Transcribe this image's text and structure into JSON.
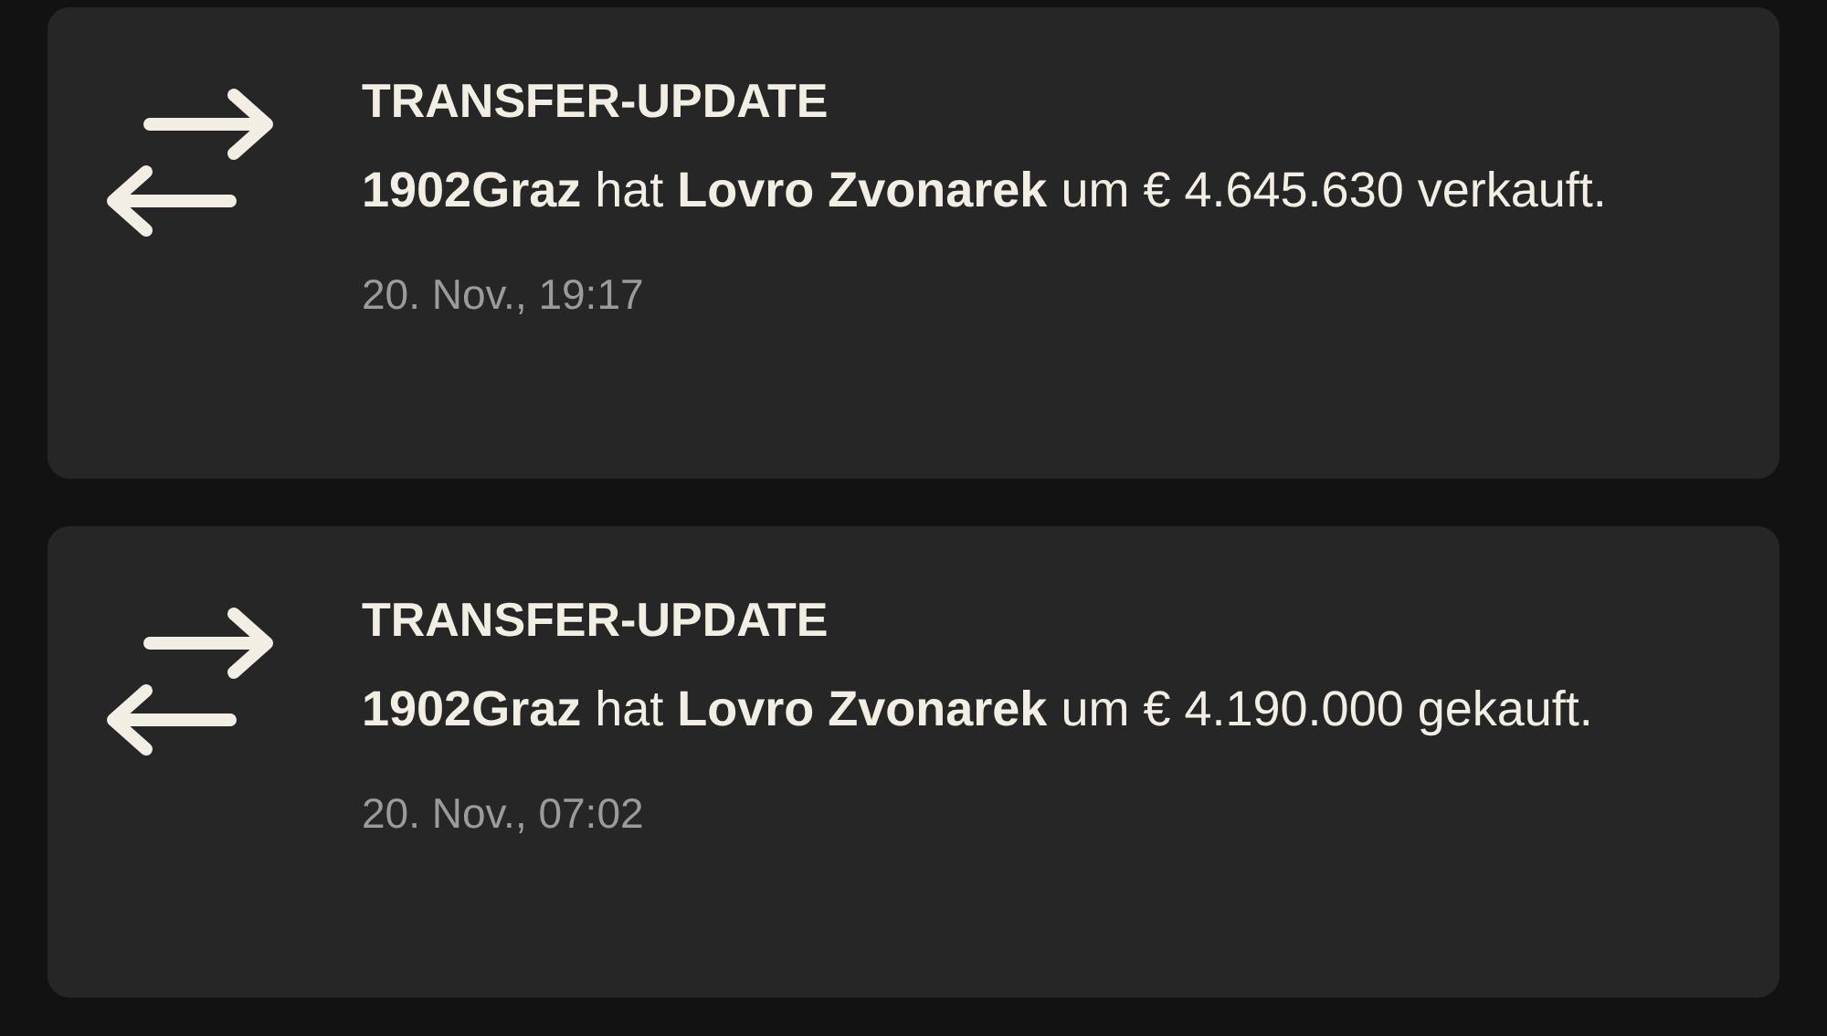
{
  "notifications": [
    {
      "title": "TRANSFER-UPDATE",
      "message": "**1902Graz** hat **Lovro Zvonarek** um € 4.645.630 verkauft.",
      "time": "20. Nov., 19:17"
    },
    {
      "title": "TRANSFER-UPDATE",
      "message": "**1902Graz** hat **Lovro Zvonarek** um € 4.190.000 gekauft.",
      "time": "20. Nov., 07:02"
    }
  ]
}
